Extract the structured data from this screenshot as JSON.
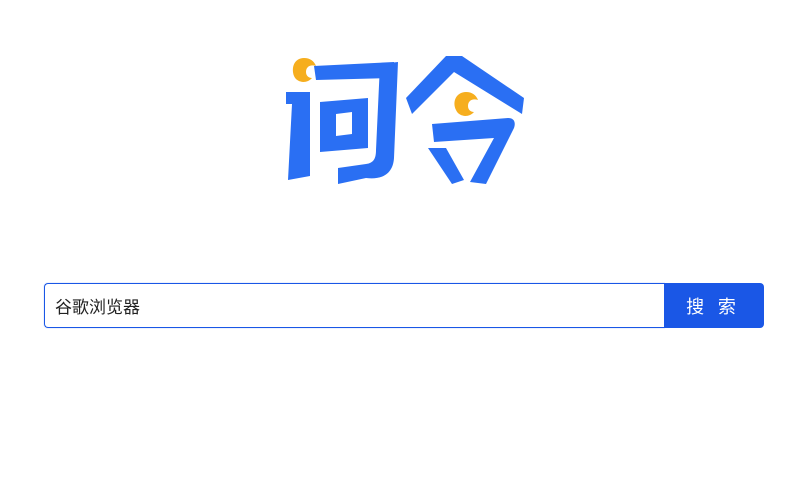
{
  "logo": {
    "text": "词令",
    "primary_color": "#2a6ff3",
    "accent_color": "#f6ae1e"
  },
  "search": {
    "value": "谷歌浏览器",
    "button_label": "搜 索",
    "accent_color": "#1a57e6"
  }
}
